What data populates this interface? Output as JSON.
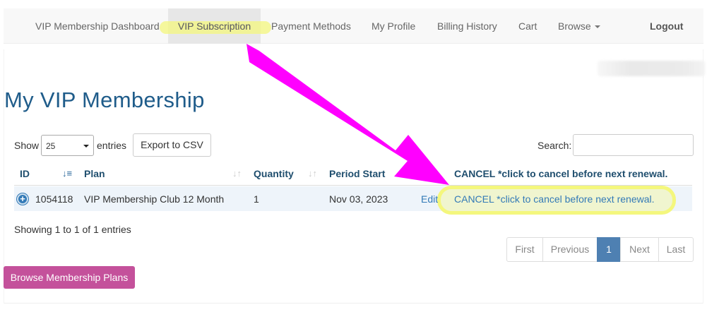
{
  "nav": {
    "items": [
      {
        "label": "VIP Membership Dashboard"
      },
      {
        "label": "VIP Subscription"
      },
      {
        "label": "Payment Methods"
      },
      {
        "label": "My Profile"
      },
      {
        "label": "Billing History"
      },
      {
        "label": "Cart"
      },
      {
        "label": "Browse"
      }
    ],
    "logout": "Logout"
  },
  "page": {
    "title": "My VIP Membership"
  },
  "controls": {
    "show_label": "Show",
    "entries_value": "25",
    "entries_label": "entries",
    "export_button": "Export to CSV",
    "search_label": "Search:"
  },
  "table": {
    "headers": {
      "id": "ID",
      "plan": "Plan",
      "quantity": "Quantity",
      "period_start": "Period Start",
      "cancel": "CANCEL *click to cancel before next renewal."
    },
    "rows": [
      {
        "id": "1054118",
        "plan": "VIP Membership Club 12 Month",
        "quantity": "1",
        "period_start": "Nov 03, 2023",
        "edit": "Edit",
        "cancel": "CANCEL *click to cancel before next renewal."
      }
    ]
  },
  "info": "Showing 1 to 1 of 1 entries",
  "pagination": {
    "first": "First",
    "previous": "Previous",
    "current": "1",
    "next": "Next",
    "last": "Last"
  },
  "footer": {
    "browse_button": "Browse Membership Plans"
  },
  "colors": {
    "title": "#1f5c8a",
    "link": "#337ab7",
    "annotation_arrow": "#ff00ff",
    "annotation_highlight": "#f4f77d",
    "browse_button": "#c4519b",
    "pagination_active": "#4e80b2"
  }
}
